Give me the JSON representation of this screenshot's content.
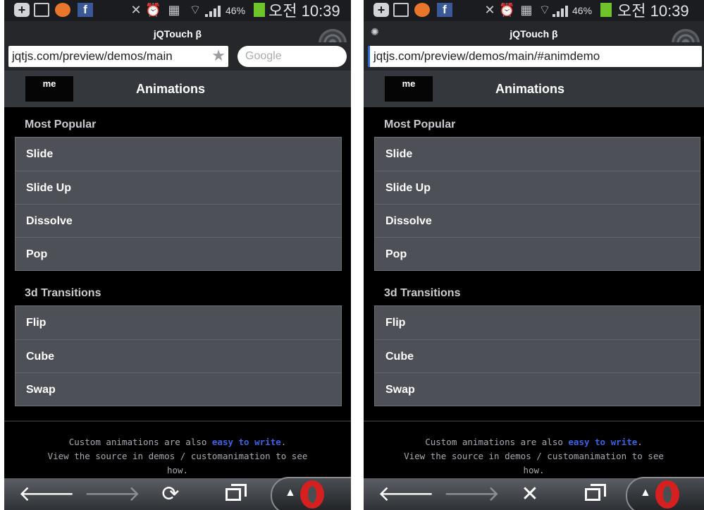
{
  "status_bar": {
    "battery_pct": "46%",
    "time": "오전 10:39"
  },
  "browser": {
    "page_title": "jQTouch β",
    "search_placeholder": "Google",
    "left": {
      "url": "jqtjs.com/preview/demos/main"
    },
    "right": {
      "url": "jqtjs.com/preview/demos/main/#animdemo"
    }
  },
  "toolbar": {
    "back_label": "me",
    "title": "Animations"
  },
  "sections": [
    {
      "heading": "Most Popular",
      "items": [
        "Slide",
        "Slide Up",
        "Dissolve",
        "Pop"
      ]
    },
    {
      "heading": "3d Transitions",
      "items": [
        "Flip",
        "Cube",
        "Swap"
      ]
    }
  ],
  "footer": {
    "line1_pre": "Custom animations are also ",
    "line1_link": "easy to write",
    "line1_post": ".",
    "line2": "View the source in demos / customanimation  to see",
    "line3": "how."
  },
  "colors": {
    "link": "#3b63e6",
    "opera_red": "#d62020",
    "battery": "#6ec42a"
  },
  "icons": {
    "left_nav": [
      "back-arrow-icon",
      "forward-arrow-icon",
      "reload-icon",
      "tabs-icon",
      "opera-menu-icon"
    ],
    "right_nav": [
      "back-arrow-icon",
      "forward-arrow-icon",
      "stop-icon",
      "tabs-icon",
      "opera-menu-icon"
    ]
  }
}
